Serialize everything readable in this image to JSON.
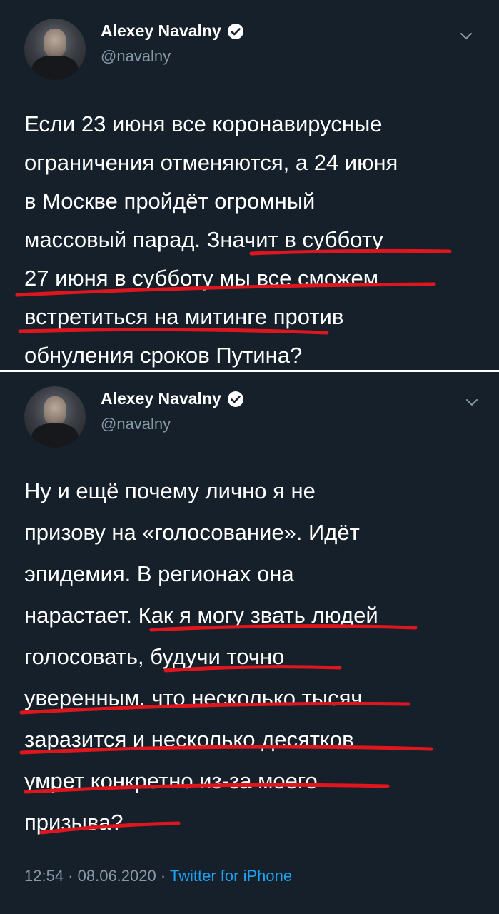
{
  "tweet1": {
    "author_name": "Alexey Navalny",
    "handle": "@navalny",
    "lines": [
      "Если 23 июня все коронавирусные",
      "ограничения отменяются, а 24 июня",
      "в Москве пройдёт огромный",
      "массовый парад. Значит в субботу",
      "27 июня в субботу мы все сможем",
      "встретиться на митинге против",
      "обнуления сроков Путина?"
    ]
  },
  "tweet2": {
    "author_name": "Alexey Navalny",
    "handle": "@navalny",
    "lines": [
      "Ну и ещё почему лично я не",
      "призову на «голосование». Идёт",
      "эпидемия. В регионах она",
      "нарастает. Как я могу звать людей",
      "голосовать, будучи точно",
      "уверенным, что несколько тысяч",
      "заразится и несколько десятков",
      "умрет конкретно из-за моего",
      "призыва?"
    ],
    "time": "12:54",
    "separator1": " · ",
    "date": "08.06.2020",
    "separator2": " · ",
    "source": "Twitter for iPhone"
  },
  "colors": {
    "background": "#15202b",
    "text": "#ffffff",
    "secondary": "#8899a6",
    "link": "#1da1f2",
    "underline": "#e0161e"
  },
  "icons": {
    "verified": "verified-badge-icon",
    "chevron": "chevron-down-icon"
  }
}
